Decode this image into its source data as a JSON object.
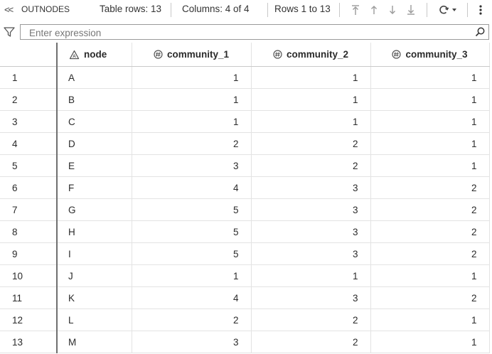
{
  "toolbar": {
    "collapse_glyph": "<<",
    "table_name": "OUTNODES",
    "table_rows": "Table rows: 13",
    "columns": "Columns: 4 of 4",
    "rows_range": "Rows 1 to 13"
  },
  "filter": {
    "placeholder": "Enter expression"
  },
  "table": {
    "columns": [
      "node",
      "community_1",
      "community_2",
      "community_3"
    ],
    "column_icons": [
      "character-column-icon",
      "numeric-column-icon",
      "numeric-column-icon",
      "numeric-column-icon"
    ],
    "rows": [
      {
        "num": "1",
        "node": "A",
        "c1": "1",
        "c2": "1",
        "c3": "1"
      },
      {
        "num": "2",
        "node": "B",
        "c1": "1",
        "c2": "1",
        "c3": "1"
      },
      {
        "num": "3",
        "node": "C",
        "c1": "1",
        "c2": "1",
        "c3": "1"
      },
      {
        "num": "4",
        "node": "D",
        "c1": "2",
        "c2": "2",
        "c3": "1"
      },
      {
        "num": "5",
        "node": "E",
        "c1": "3",
        "c2": "2",
        "c3": "1"
      },
      {
        "num": "6",
        "node": "F",
        "c1": "4",
        "c2": "3",
        "c3": "2"
      },
      {
        "num": "7",
        "node": "G",
        "c1": "5",
        "c2": "3",
        "c3": "2"
      },
      {
        "num": "8",
        "node": "H",
        "c1": "5",
        "c2": "3",
        "c3": "2"
      },
      {
        "num": "9",
        "node": "I",
        "c1": "5",
        "c2": "3",
        "c3": "2"
      },
      {
        "num": "10",
        "node": "J",
        "c1": "1",
        "c2": "1",
        "c3": "1"
      },
      {
        "num": "11",
        "node": "K",
        "c1": "4",
        "c2": "3",
        "c3": "2"
      },
      {
        "num": "12",
        "node": "L",
        "c1": "2",
        "c2": "2",
        "c3": "1"
      },
      {
        "num": "13",
        "node": "M",
        "c1": "3",
        "c2": "2",
        "c3": "1"
      }
    ]
  },
  "colors": {
    "text": "#2b2b2b",
    "border": "#e3e3e3",
    "icon": "#555555"
  }
}
